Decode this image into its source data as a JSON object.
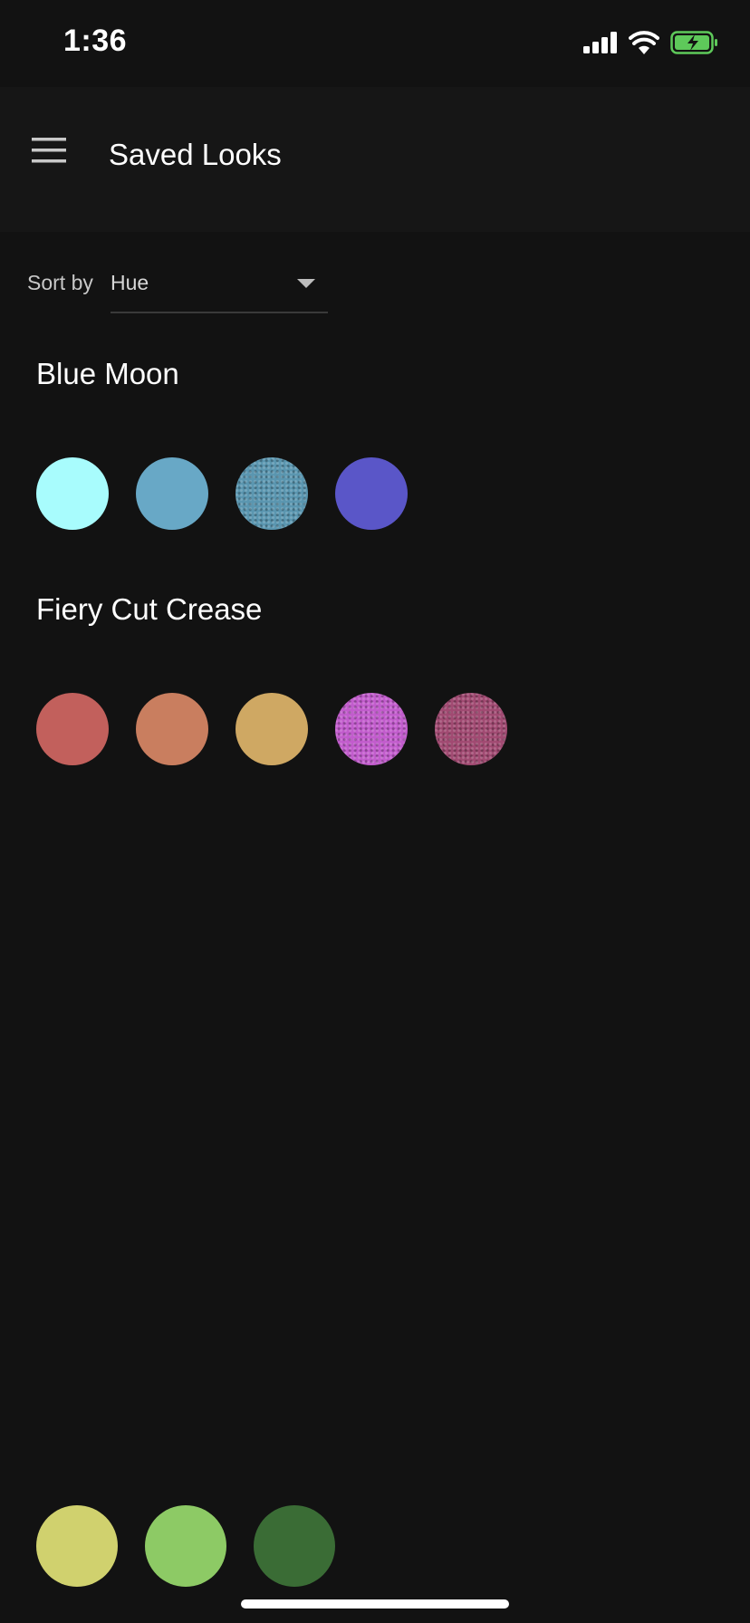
{
  "status_bar": {
    "time": "1:36",
    "signal_icon": "cellular-signal-icon",
    "wifi_icon": "wifi-icon",
    "battery_icon": "battery-charging-icon",
    "battery_color": "#5ec95a"
  },
  "app_bar": {
    "menu_icon": "hamburger-menu-icon",
    "title": "Saved Looks"
  },
  "sort": {
    "label": "Sort by",
    "selected": "Hue",
    "dropdown_icon": "caret-down-icon"
  },
  "looks": [
    {
      "name": "Blue Moon",
      "colors": [
        "#a8fcfd",
        "#68a8c6",
        "#5a96b0",
        "#5a56c8"
      ],
      "shimmer": [
        false,
        false,
        true,
        false
      ]
    },
    {
      "name": "Fiery Cut Crease",
      "colors": [
        "#c2605c",
        "#c97e5f",
        "#cfa863",
        "#c25ccd",
        "#a14a72"
      ],
      "shimmer": [
        false,
        false,
        false,
        true,
        true
      ]
    }
  ],
  "bottom_swatches": {
    "colors": [
      "#d0d16e",
      "#8dca65",
      "#3a6c35"
    ]
  },
  "theme": {
    "background": "#121212",
    "app_bar_background": "#161616",
    "text_primary": "#ffffff",
    "text_secondary": "#c8c8c8"
  }
}
